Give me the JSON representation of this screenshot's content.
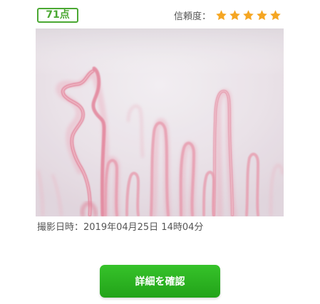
{
  "score": {
    "label": "71点",
    "color": "#4aa832"
  },
  "reliability": {
    "label": "信頼度：",
    "rating": 5,
    "max": 5,
    "star_color": "#f5a623",
    "star_icon": "star-icon"
  },
  "photo": {
    "subject": "capillary-microscope-image"
  },
  "capture": {
    "text": "撮影日時：2019年04月25日 14時04分"
  },
  "actions": {
    "detail_label": "詳細を確認",
    "button_color": "#2db424"
  }
}
